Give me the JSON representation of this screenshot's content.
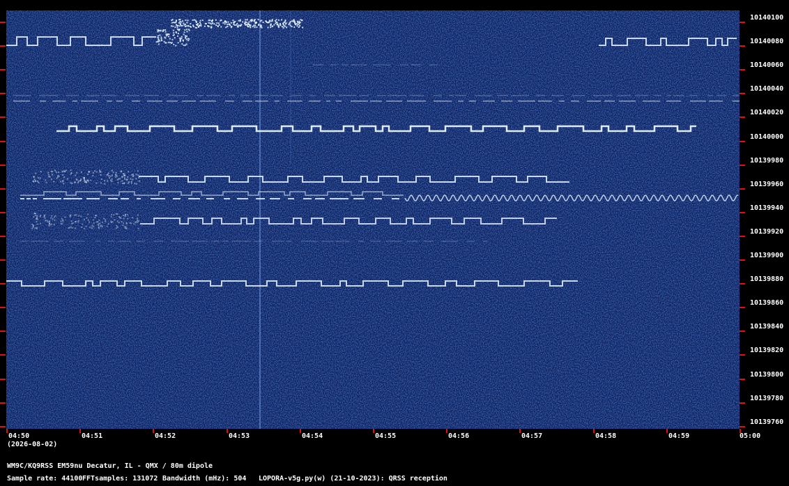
{
  "date_label": "(2026-08-02)",
  "station_line": "WM9C/KQ9RSS EM59nu Decatur, IL - QMX / 80m dipole",
  "sample_rate_text": "Sample rate: 44100",
  "fft_text": "FFTsamples: 131072",
  "bandwidth_text": "Bandwidth (mHz): 504",
  "software_text": "LOPORA-v5g.py(w) (21-10-2023): QRSS reception",
  "colors": {
    "background": "#000000",
    "spectrogram": "#0b1f5c",
    "trace": "#e8f4ff",
    "tick": "#e01010",
    "label": "#ffffff"
  },
  "frequency_labels": [
    "10140100",
    "10140080",
    "10140060",
    "10140040",
    "10140020",
    "10140000",
    "10139980",
    "10139960",
    "10139940",
    "10139920",
    "10139900",
    "10139880",
    "10139860",
    "10139840",
    "10139820",
    "10139800",
    "10139780",
    "10139760"
  ],
  "time_labels": [
    "04:50",
    "04:51",
    "04:52",
    "04:53",
    "04:54",
    "04:55",
    "04:56",
    "04:57",
    "04:58",
    "04:59",
    "05:00"
  ]
}
